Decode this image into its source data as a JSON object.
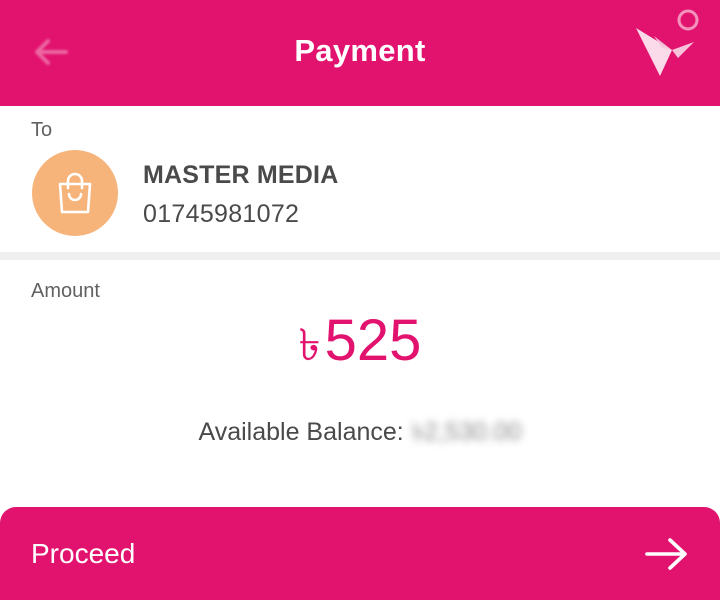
{
  "header": {
    "title": "Payment",
    "back_icon": "arrow-left-icon",
    "logo_icon": "bkash-bird-logo"
  },
  "recipient": {
    "label": "To",
    "avatar_icon": "shopping-bag-icon",
    "name": "MASTER MEDIA",
    "number": "01745981072"
  },
  "amount": {
    "label": "Amount",
    "currency_symbol": "৳",
    "value": "525"
  },
  "balance": {
    "label": "Available Balance:",
    "value": "৳2,530.00"
  },
  "proceed": {
    "label": "Proceed",
    "icon": "arrow-right-icon"
  },
  "colors": {
    "brand": "#e2136e",
    "avatar_bg": "#f6b47b",
    "text_dark": "#4a4a4a",
    "text_muted": "#616161"
  }
}
